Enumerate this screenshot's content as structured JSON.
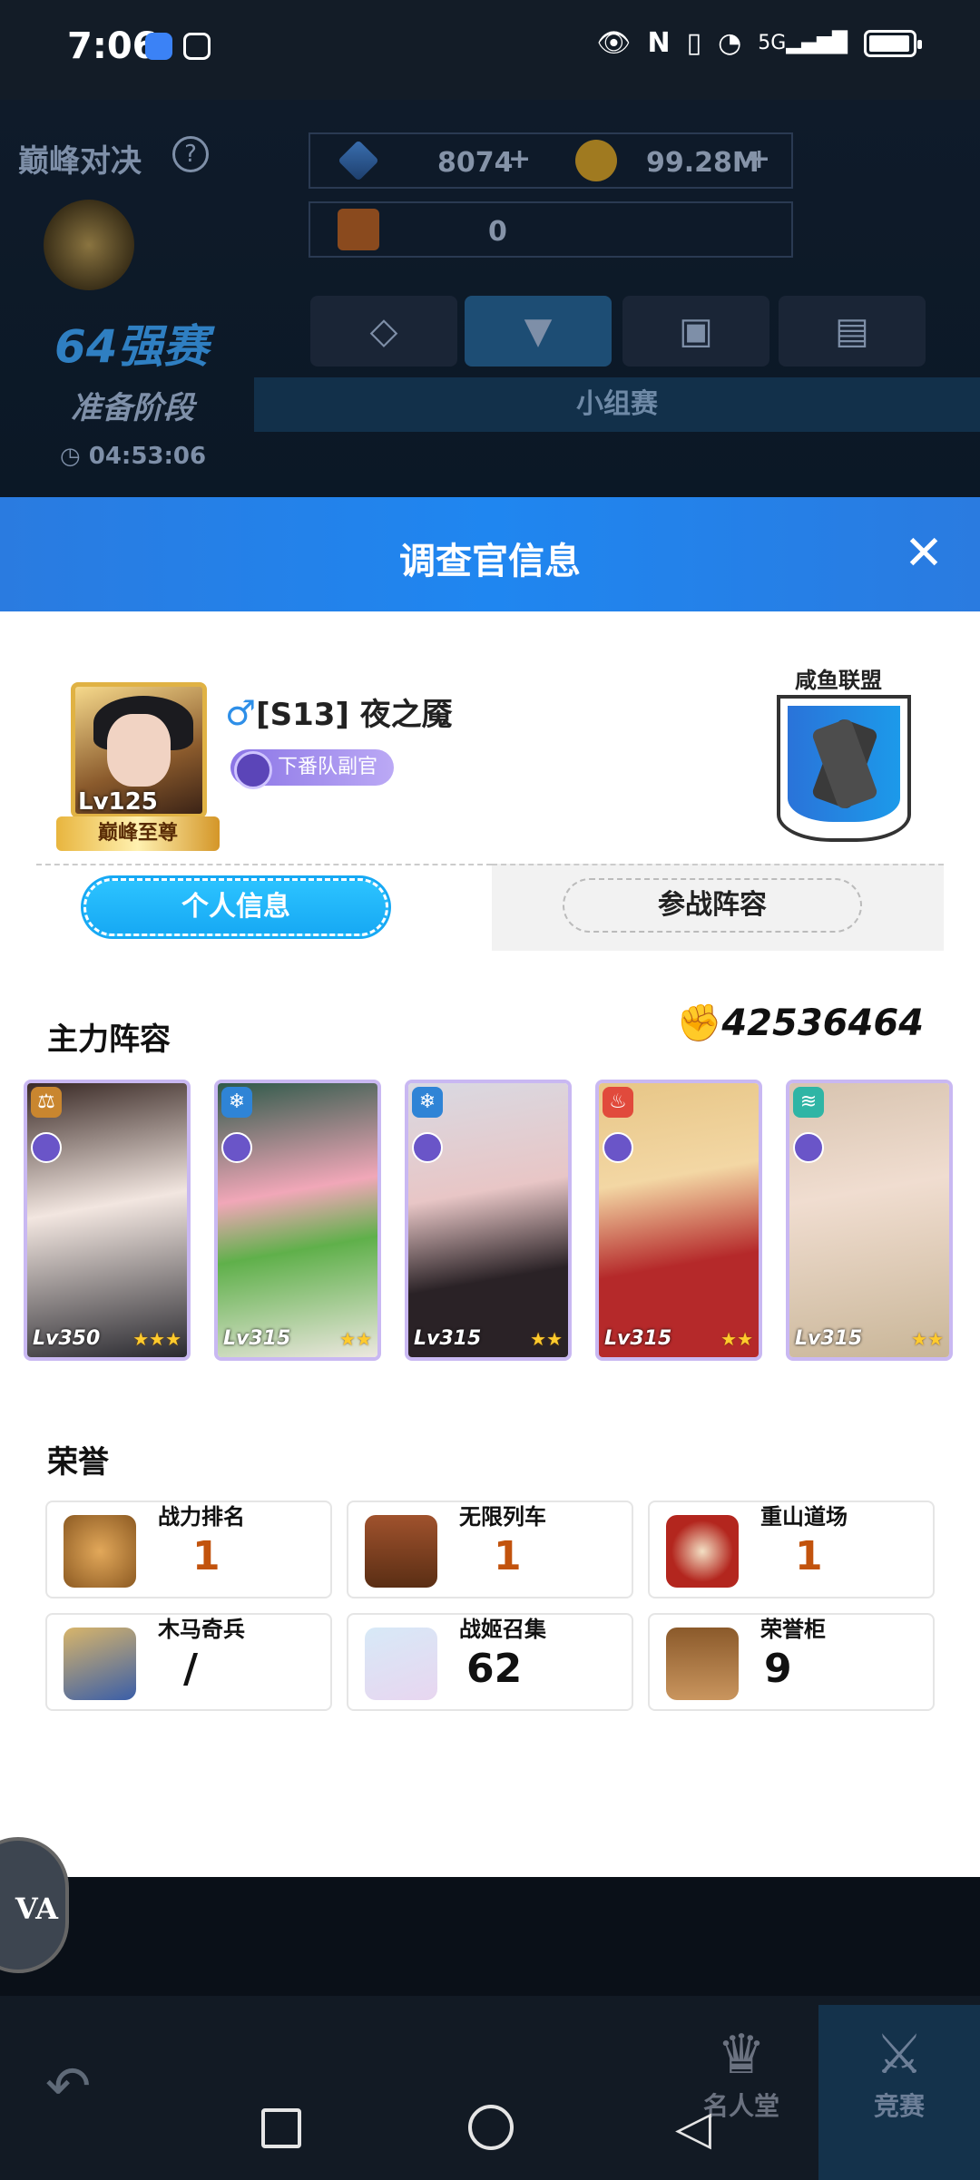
{
  "status_bar": {
    "time": "7:06",
    "net_type": "5G"
  },
  "game": {
    "mode_title": "巅峰对决",
    "round": "64强赛",
    "phase": "准备阶段",
    "timer": "04:53:06",
    "diamonds": "8074",
    "gold": "99.28M",
    "tickets": "0",
    "group_label": "小组赛"
  },
  "dialog": {
    "title": "调查官信息",
    "player": {
      "name": "[S13] 夜之魇",
      "level": "Lv125",
      "rank_badge": "巅峰至尊",
      "title_badge": "下番队副官",
      "guild_name": "咸鱼联盟"
    },
    "tabs": {
      "personal": "个人信息",
      "lineup": "参战阵容"
    },
    "main_lineup": {
      "heading": "主力阵容",
      "power": "42536464",
      "cards": [
        {
          "level": "Lv350",
          "stars": "★★★",
          "element_color": "#c9862f"
        },
        {
          "level": "Lv315",
          "stars": "★★",
          "element_color": "#2f84d6"
        },
        {
          "level": "Lv315",
          "stars": "★★",
          "element_color": "#2f84d6"
        },
        {
          "level": "Lv315",
          "stars": "★★",
          "element_color": "#e14a3c"
        },
        {
          "level": "Lv315",
          "stars": "★★",
          "element_color": "#2fb5a5"
        }
      ]
    },
    "honors": {
      "heading": "荣誉",
      "items": [
        {
          "label": "战力排名",
          "value": "1",
          "icon": "fist-icon"
        },
        {
          "label": "无限列车",
          "value": "1",
          "icon": "train-icon"
        },
        {
          "label": "重山道场",
          "value": "1",
          "icon": "drum-icon"
        },
        {
          "label": "木马奇兵",
          "value": "/",
          "icon": "knight-icon"
        },
        {
          "label": "战姬召集",
          "value": "62",
          "icon": "silhouette-icon"
        },
        {
          "label": "荣誉柜",
          "value": "9",
          "icon": "cabinet-icon"
        }
      ]
    }
  },
  "bottom_nav": {
    "hall": "名人堂",
    "arena": "竞赛"
  },
  "floating": {
    "label": "VA"
  }
}
